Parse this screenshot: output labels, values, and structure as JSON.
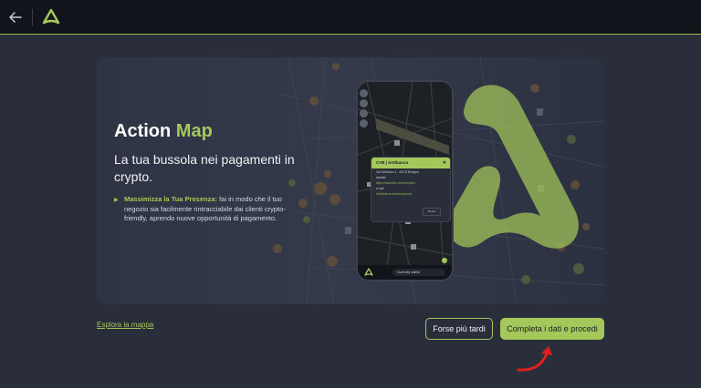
{
  "topbar": {
    "back_icon": "arrow-left-icon",
    "logo_icon": "brand-logo-icon"
  },
  "hero": {
    "title_main": "Action",
    "title_accent": "Map",
    "subtitle": "La tua bussola nei pagamenti in crypto.",
    "bullet_strong": "Massimizza la Tua Presenza:",
    "bullet_text": " fai in modo che il tuo negozio sia facilmente rintracciabile dai clienti crypto-friendly, aprendo nuove opportunità di pagamento."
  },
  "phone": {
    "popup_title": "CVB | Sottbanco",
    "popup_address": "Via Sottbanco 1 - 40123 Bologna",
    "popup_site_label": "website",
    "popup_site": "https://www.sito.com/shop/sito",
    "popup_email_label": "e-mail",
    "popup_email": "info@sitoservicesbologna.it",
    "popup_route": "Route",
    "status_pill": "Currently visible"
  },
  "actions": {
    "explore": "Esplora la mappa",
    "later": "Forse più tardi",
    "proceed": "Completa i dati e procedi"
  },
  "colors": {
    "accent": "#a5c85a",
    "background": "#2a2d3a",
    "topbar": "#12141c",
    "annotation": "#e0201b"
  }
}
